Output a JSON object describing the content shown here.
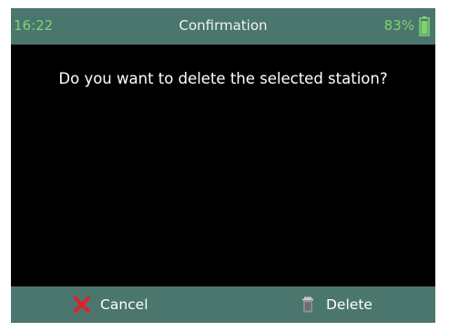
{
  "status_bar": {
    "time": "16:22",
    "title": "Confirmation",
    "battery_percent": "83%",
    "battery_icon": "battery-icon"
  },
  "dialog": {
    "message": "Do you want to delete the selected station?"
  },
  "actions": {
    "cancel_label": "Cancel",
    "cancel_icon": "close-x-icon",
    "delete_label": "Delete",
    "delete_icon": "trash-icon"
  },
  "colors": {
    "bar_background": "#4a766e",
    "screen_background": "#000000",
    "status_text_green": "#7fd36e",
    "cancel_icon_red": "#e0202a"
  }
}
